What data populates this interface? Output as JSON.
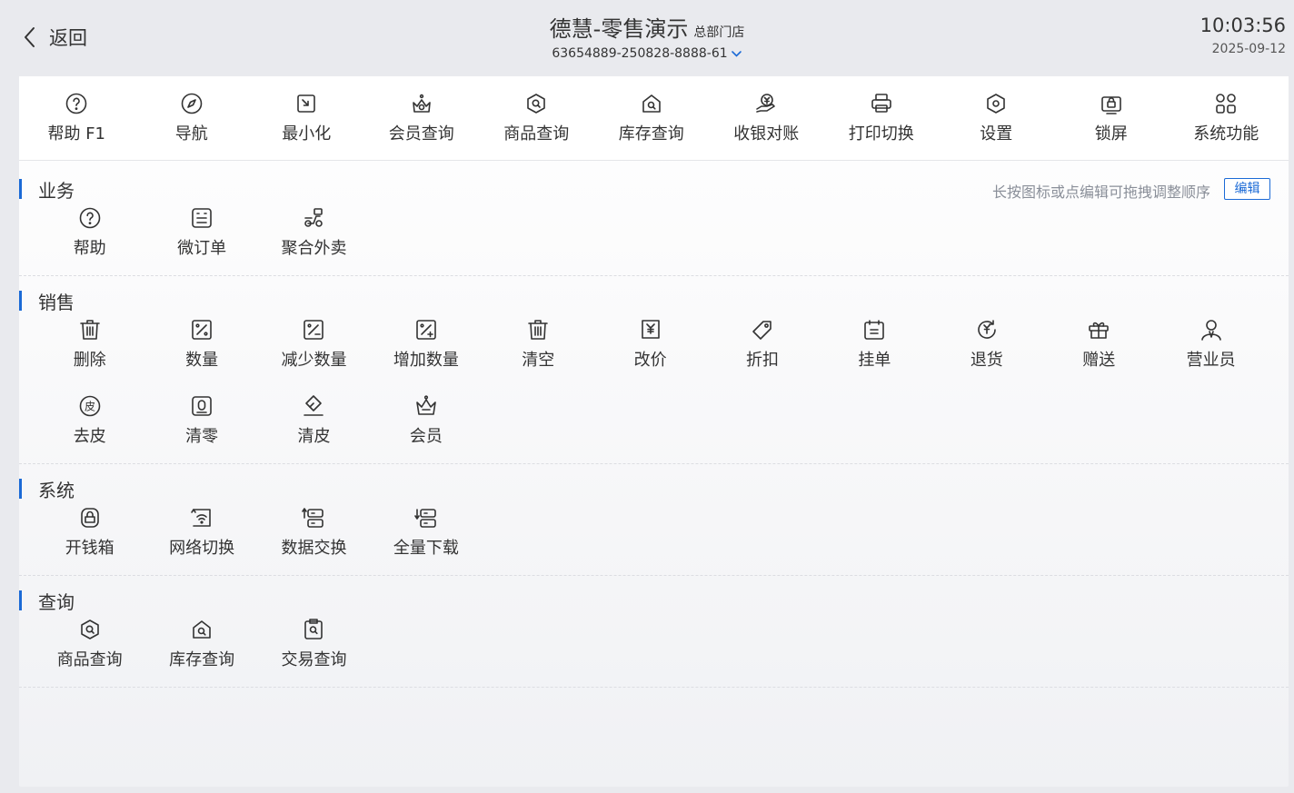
{
  "header": {
    "back_label": "返回",
    "store_title": "德慧-零售演示",
    "store_badge": "总部门店",
    "store_id": "63654889-250828-8888-61",
    "time": "10:03:56",
    "date": "2025-09-12"
  },
  "toolbar": [
    {
      "label": "帮助 F1",
      "icon": "help-icon"
    },
    {
      "label": "导航",
      "icon": "compass-icon"
    },
    {
      "label": "最小化",
      "icon": "minimize-icon"
    },
    {
      "label": "会员查询",
      "icon": "member-search-icon"
    },
    {
      "label": "商品查询",
      "icon": "product-search-icon"
    },
    {
      "label": "库存查询",
      "icon": "stock-search-icon"
    },
    {
      "label": "收银对账",
      "icon": "reconcile-icon"
    },
    {
      "label": "打印切换",
      "icon": "printer-icon"
    },
    {
      "label": "设置",
      "icon": "settings-icon"
    },
    {
      "label": "锁屏",
      "icon": "lock-screen-icon"
    },
    {
      "label": "系统功能",
      "icon": "apps-icon"
    }
  ],
  "hint": "长按图标或点编辑可拖拽调整顺序",
  "edit_label": "编辑",
  "sections": [
    {
      "title": "业务",
      "items": [
        {
          "label": "帮助",
          "icon": "help-icon"
        },
        {
          "label": "微订单",
          "icon": "order-icon"
        },
        {
          "label": "聚合外卖",
          "icon": "scooter-icon"
        }
      ]
    },
    {
      "title": "销售",
      "items": [
        {
          "label": "删除",
          "icon": "trash-icon"
        },
        {
          "label": "数量",
          "icon": "quantity-icon"
        },
        {
          "label": "减少数量",
          "icon": "quantity-minus-icon"
        },
        {
          "label": "增加数量",
          "icon": "quantity-plus-icon"
        },
        {
          "label": "清空",
          "icon": "trash-icon"
        },
        {
          "label": "改价",
          "icon": "price-icon"
        },
        {
          "label": "折扣",
          "icon": "tag-icon"
        },
        {
          "label": "挂单",
          "icon": "hold-icon"
        },
        {
          "label": "退货",
          "icon": "refund-icon"
        },
        {
          "label": "赠送",
          "icon": "gift-icon"
        },
        {
          "label": "营业员",
          "icon": "user-icon"
        },
        {
          "label": "去皮",
          "icon": "tare-icon"
        },
        {
          "label": "清零",
          "icon": "zero-icon"
        },
        {
          "label": "清皮",
          "icon": "eraser-icon"
        },
        {
          "label": "会员",
          "icon": "crown-icon"
        }
      ]
    },
    {
      "title": "系统",
      "items": [
        {
          "label": "开钱箱",
          "icon": "cash-box-icon"
        },
        {
          "label": "网络切换",
          "icon": "wifi-icon"
        },
        {
          "label": "数据交换",
          "icon": "data-exchange-icon"
        },
        {
          "label": "全量下载",
          "icon": "download-icon"
        }
      ]
    },
    {
      "title": "查询",
      "items": [
        {
          "label": "商品查询",
          "icon": "product-search-icon"
        },
        {
          "label": "库存查询",
          "icon": "stock-search-icon"
        },
        {
          "label": "交易查询",
          "icon": "transaction-search-icon"
        }
      ]
    }
  ]
}
